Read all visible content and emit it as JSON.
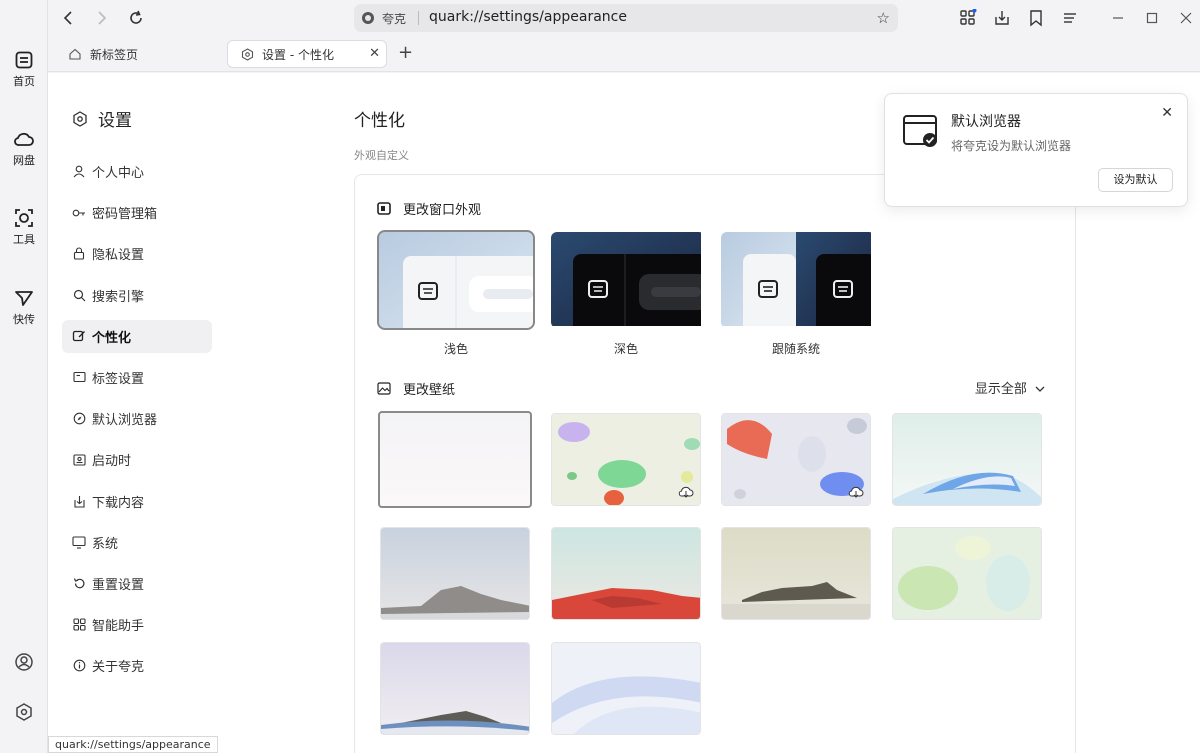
{
  "rail": {
    "items": [
      {
        "label": "首页",
        "icon": "home-icon"
      },
      {
        "label": "网盘",
        "icon": "cloud-icon"
      },
      {
        "label": "工具",
        "icon": "tools-icon"
      },
      {
        "label": "快传",
        "icon": "send-icon"
      }
    ],
    "bottom": [
      {
        "icon": "account-icon"
      },
      {
        "icon": "settings-icon"
      }
    ]
  },
  "address_bar": {
    "site_name": "夸克",
    "url": "quark://settings/appearance"
  },
  "tabs": [
    {
      "label": "新标签页",
      "icon": "home-outline-icon",
      "active": false
    },
    {
      "label": "设置 - 个性化",
      "icon": "settings-icon",
      "active": true
    }
  ],
  "settings": {
    "title": "设置",
    "menu": [
      {
        "label": "个人中心",
        "icon": "user-icon"
      },
      {
        "label": "密码管理箱",
        "icon": "key-icon"
      },
      {
        "label": "隐私设置",
        "icon": "lock-icon"
      },
      {
        "label": "搜索引擎",
        "icon": "search-icon"
      },
      {
        "label": "个性化",
        "icon": "personalize-icon",
        "active": true
      },
      {
        "label": "标签设置",
        "icon": "tab-icon"
      },
      {
        "label": "默认浏览器",
        "icon": "compass-icon"
      },
      {
        "label": "启动时",
        "icon": "startup-icon"
      },
      {
        "label": "下载内容",
        "icon": "download-icon"
      },
      {
        "label": "系统",
        "icon": "monitor-icon"
      },
      {
        "label": "重置设置",
        "icon": "reset-icon"
      },
      {
        "label": "智能助手",
        "icon": "grid-icon"
      },
      {
        "label": "关于夸克",
        "icon": "info-icon"
      }
    ]
  },
  "page": {
    "heading": "个性化",
    "subheading": "外观自定义",
    "window_section": {
      "title": "更改窗口外观",
      "themes": [
        {
          "label": "浅色",
          "selected": true
        },
        {
          "label": "深色",
          "selected": false
        },
        {
          "label": "跟随系统",
          "selected": false
        }
      ]
    },
    "wallpaper_section": {
      "title": "更改壁纸",
      "show_all": "显示全部"
    }
  },
  "popup": {
    "title": "默认浏览器",
    "desc": "将夸克设为默认浏览器",
    "button": "设为默认"
  },
  "status_url": "quark://settings/appearance",
  "colors": {
    "background": "#f3f3f5",
    "content": "#ffffff",
    "accent_blue": "#1a5cff",
    "selection_outline": "#888888"
  }
}
